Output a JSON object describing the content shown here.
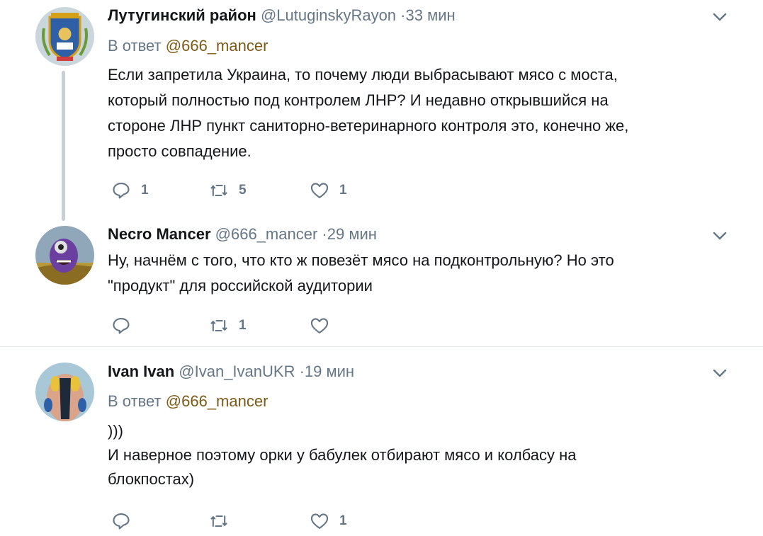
{
  "tweets": [
    {
      "name": "Лутугинский район",
      "handle": "@LutuginskyRayon",
      "time": "·33 мин",
      "reply_prefix": "В ответ",
      "reply_mention": "@666_mancer",
      "lines": [
        "Если запретила Украина, то почему люди выбрасывают мясо с моста,",
        "который полностью под контролем ЛНР? И недавно открывшийся на",
        "стороне ЛНР пункт саниторно-ветеринарного контроля это, конечно же,",
        "просто совпадение."
      ],
      "replies": "1",
      "retweets": "5",
      "likes": "1"
    },
    {
      "name": "Necro Mancer",
      "handle": "@666_mancer",
      "time": "·29 мин",
      "lines": [
        "Ну, начнём с того, что кто ж повезёт мясо на подконтрольную? Но это",
        "\"продукт\" для российской аудитории"
      ],
      "replies": "",
      "retweets": "1",
      "likes": ""
    },
    {
      "name": "Ivan Ivan",
      "handle": "@Ivan_IvanUKR",
      "time": "·19 мин",
      "reply_prefix": "В ответ",
      "reply_mention": "@666_mancer",
      "lines": [
        ")))",
        "И наверное поэтому орки у бабулек отбирают мясо и колбасу на",
        "блокпостах)"
      ],
      "replies": "",
      "retweets": "",
      "likes": "1"
    }
  ],
  "icons": {
    "reply": "reply-icon",
    "retweet": "retweet-icon",
    "like": "heart-icon",
    "more": "chevron-down-icon"
  },
  "colors": {
    "icon_gray": "#657786",
    "mention": "#7c5a16",
    "thread_line": "#c7cfd6"
  }
}
